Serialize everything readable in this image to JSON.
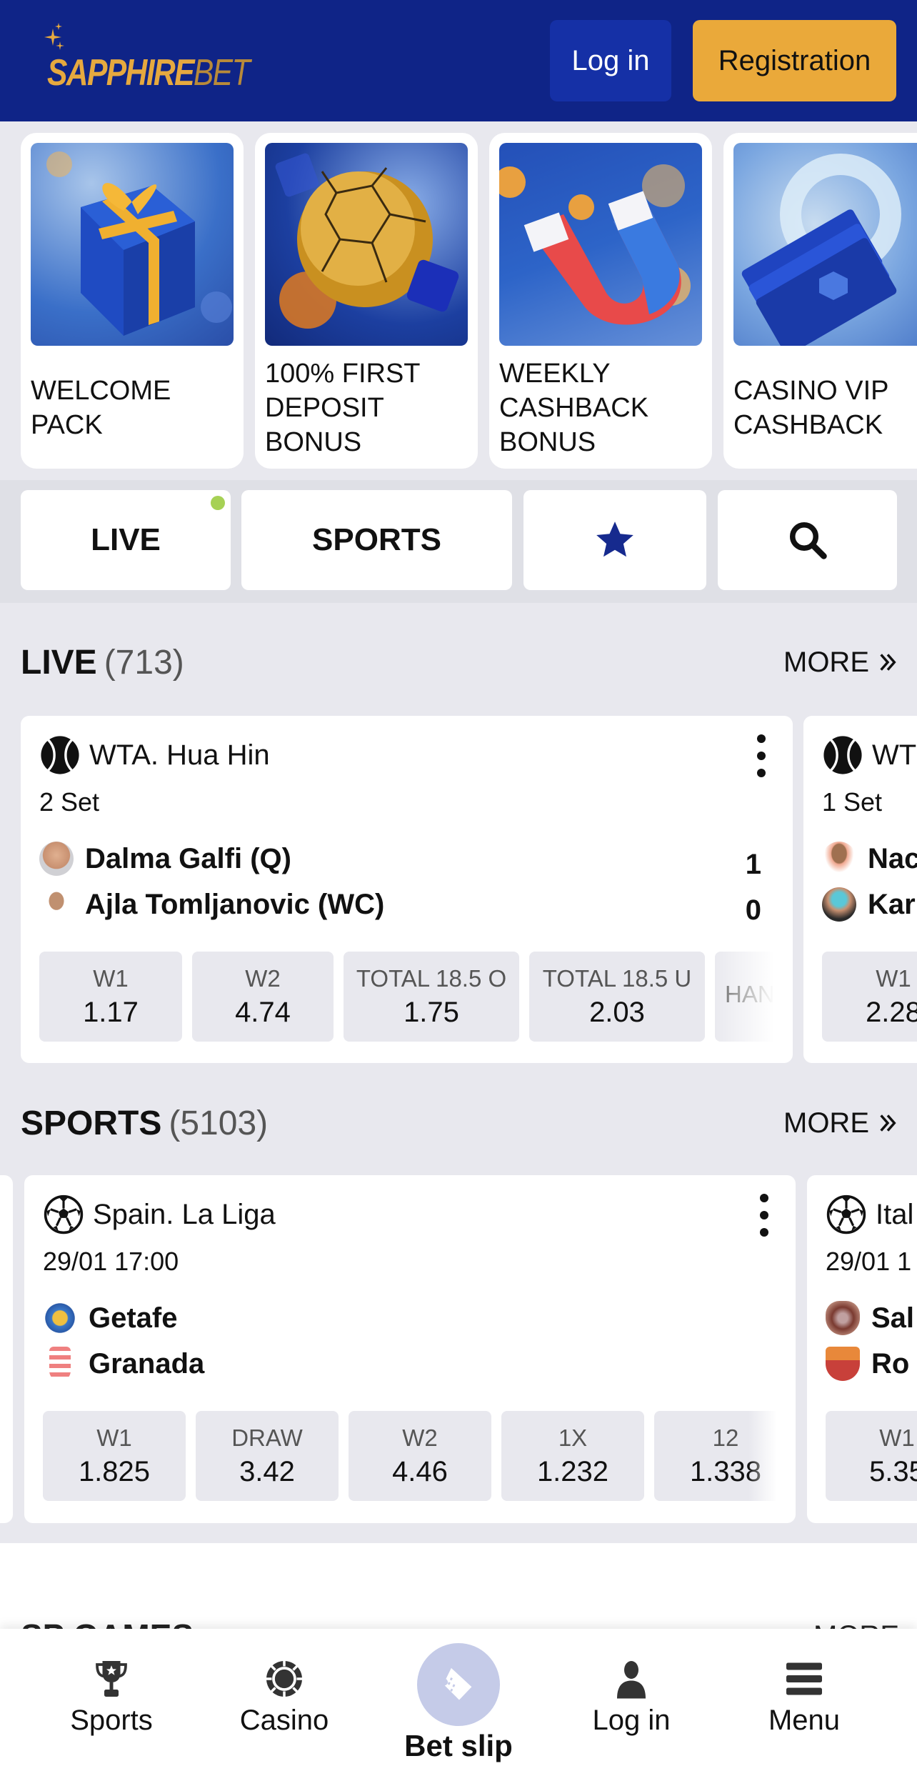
{
  "header": {
    "logo_bold": "SAPPHIRE",
    "logo_light": "BET",
    "login_label": "Log in",
    "register_label": "Registration",
    "brand_color": "#0f2487",
    "accent_color": "#eaa93a"
  },
  "promos": [
    {
      "title": "WELCOME PACK",
      "image": "gift-box"
    },
    {
      "title": "100% FIRST DEPOSIT BONUS",
      "image": "golden-ball"
    },
    {
      "title": "WEEKLY CASHBACK BONUS",
      "image": "magnet"
    },
    {
      "title": "CASINO VIP CASHBACK",
      "image": "banknotes"
    }
  ],
  "tabs": {
    "live": "LIVE",
    "sports": "SPORTS",
    "favorites_icon": "star-icon",
    "search_icon": "search-icon"
  },
  "live": {
    "title": "LIVE",
    "count": "(713)",
    "more": "MORE",
    "events": [
      {
        "league": "WTA. Hua Hin",
        "sport_icon": "tennis-ball-icon",
        "status": "2 Set",
        "team1": "Dalma Galfi (Q)",
        "team2": "Ajla Tomljanovic (WC)",
        "score1": "1",
        "score2": "0",
        "odds": [
          {
            "label": "W1",
            "value": "1.17"
          },
          {
            "label": "W2",
            "value": "4.74"
          },
          {
            "label": "TOTAL 18.5 O",
            "value": "1.75"
          },
          {
            "label": "TOTAL 18.5 U",
            "value": "2.03"
          },
          {
            "label": "HAN",
            "value": ""
          }
        ]
      },
      {
        "league": "WT",
        "sport_icon": "tennis-ball-icon",
        "status": "1 Set",
        "team1": "Nac",
        "team2": "Kar",
        "odds": [
          {
            "label": "W1",
            "value": "2.28"
          }
        ]
      }
    ]
  },
  "sports": {
    "title": "SPORTS",
    "count": "(5103)",
    "more": "MORE",
    "events": [
      {
        "league": "Spain. La Liga",
        "sport_icon": "soccer-ball-icon",
        "time": "29/01 17:00",
        "team1": "Getafe",
        "team2": "Granada",
        "odds": [
          {
            "label": "W1",
            "value": "1.825"
          },
          {
            "label": "DRAW",
            "value": "3.42"
          },
          {
            "label": "W2",
            "value": "4.46"
          },
          {
            "label": "1X",
            "value": "1.232"
          },
          {
            "label": "12",
            "value": "1.338"
          }
        ]
      },
      {
        "league": "Ital",
        "sport_icon": "soccer-ball-icon",
        "time": "29/01 1",
        "team1": "Sal",
        "team2": "Ro",
        "odds": [
          {
            "label": "W1",
            "value": "5.35"
          }
        ]
      }
    ]
  },
  "next_section": {
    "title": "SP GAMES",
    "more": "MORE"
  },
  "bottom_nav": {
    "sports": "Sports",
    "casino": "Casino",
    "betslip": "Bet slip",
    "login": "Log in",
    "menu": "Menu"
  }
}
